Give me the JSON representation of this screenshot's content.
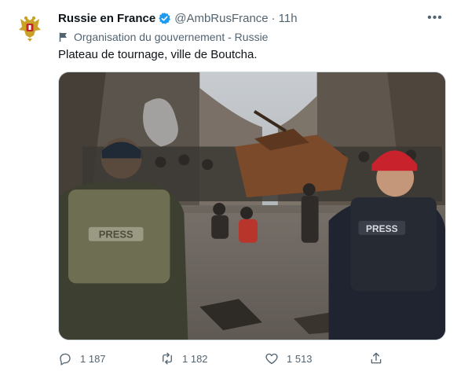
{
  "tweet": {
    "display_name": "Russie en France",
    "verified_icon": "verified-badge-icon",
    "handle": "@AmbRusFrance",
    "separator": "·",
    "time": "11h",
    "more_icon": "more-options-icon",
    "label": "Organisation du gouvernement - Russie",
    "label_icon": "flag-icon",
    "text": "Plateau de tournage, ville de Boutcha.",
    "media_alt_vest_left": "PRESS",
    "media_alt_vest_right": "PRESS"
  },
  "actions": {
    "reply_count": "1 187",
    "retweet_count": "1 182",
    "like_count": "1 513",
    "icons": [
      "reply-icon",
      "retweet-icon",
      "like-icon",
      "share-icon"
    ]
  },
  "colors": {
    "verified": "#1d9bf0",
    "secondary_text": "#536471",
    "primary_text": "#0f1419"
  }
}
